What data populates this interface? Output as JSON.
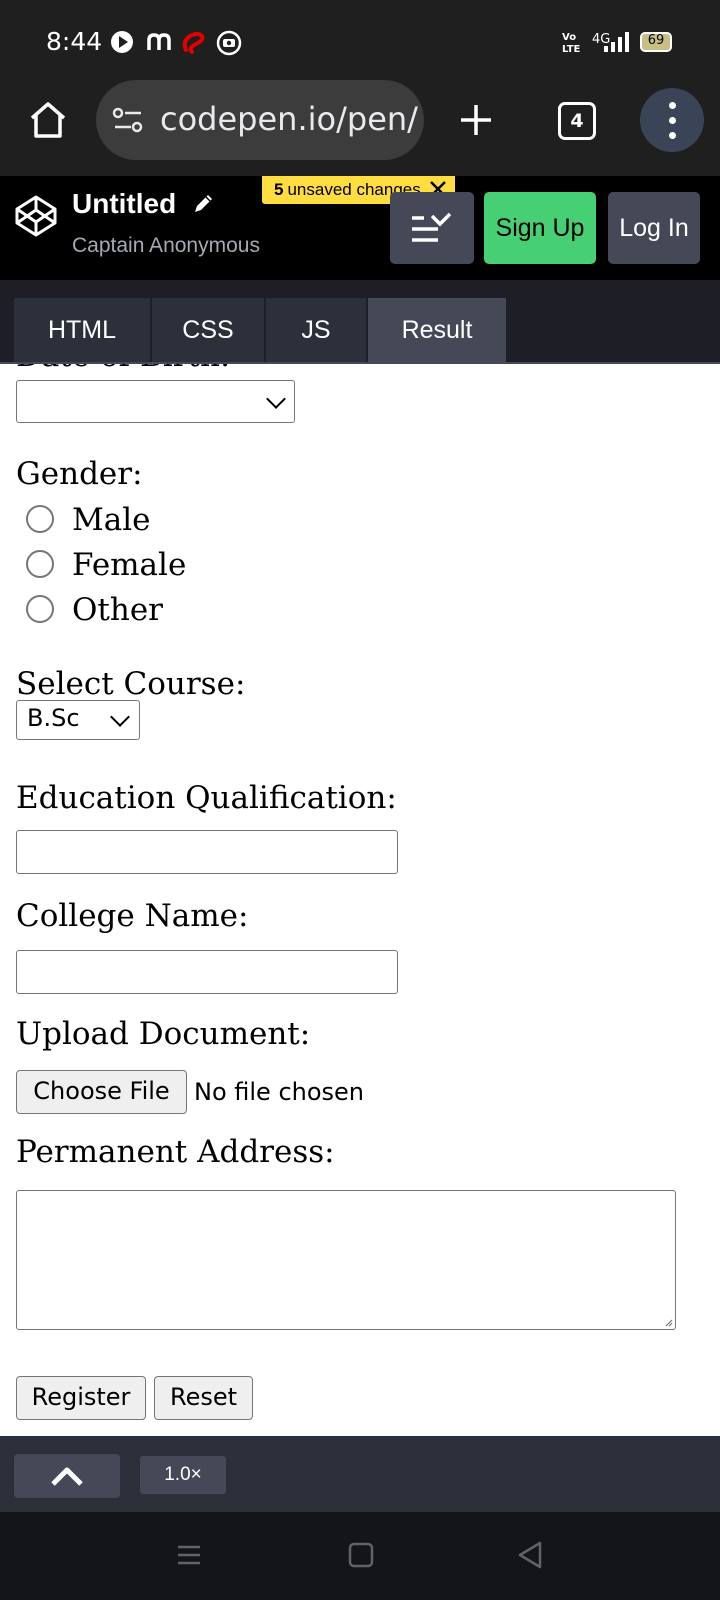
{
  "status_bar": {
    "time": "8:44",
    "network": "4G",
    "battery": "69",
    "icons": [
      "play-circle-icon",
      "m-app-icon",
      "airtel-icon",
      "camera-badge-icon",
      "volte-icon",
      "signal-icon",
      "battery-icon"
    ]
  },
  "browser": {
    "url": "codepen.io/pen/",
    "tab_count": "4",
    "icons": [
      "home-icon",
      "site-settings-icon",
      "new-tab-plus-icon",
      "tab-switcher-icon",
      "more-menu-icon"
    ]
  },
  "codepen": {
    "pen_title": "Untitled",
    "author": "Captain Anonymous",
    "unsaved_count": "5",
    "unsaved_text": "unsaved changes",
    "signup_label": "Sign Up",
    "login_label": "Log In",
    "icons": [
      "codepen-logo-icon",
      "pencil-icon",
      "close-icon",
      "view-layout-icon"
    ]
  },
  "tabs": [
    {
      "label": "HTML",
      "active": false
    },
    {
      "label": "CSS",
      "active": false
    },
    {
      "label": "JS",
      "active": false
    },
    {
      "label": "Result",
      "active": true
    }
  ],
  "form": {
    "dob_label": "Date of Birth:",
    "dob_value": "",
    "gender_label": "Gender:",
    "gender_options": [
      "Male",
      "Female",
      "Other"
    ],
    "course_label": "Select Course:",
    "course_value": "B.Sc",
    "education_label": "Education Qualification:",
    "education_value": "",
    "college_label": "College Name:",
    "college_value": "",
    "upload_label": "Upload Document:",
    "choose_file_label": "Choose File",
    "file_status": "No file chosen",
    "address_label": "Permanent Address:",
    "address_value": "",
    "register_label": "Register",
    "reset_label": "Reset"
  },
  "console": {
    "zoom": "1.0×",
    "icons": [
      "chevron-up-icon"
    ]
  },
  "nav_bar": {
    "icons": [
      "recents-icon",
      "home-square-icon",
      "back-triangle-icon"
    ]
  },
  "colors": {
    "signup_green": "#47cf73",
    "unsaved_yellow": "#ffdd40",
    "tab_active": "#444857",
    "header_bg": "#000000"
  }
}
